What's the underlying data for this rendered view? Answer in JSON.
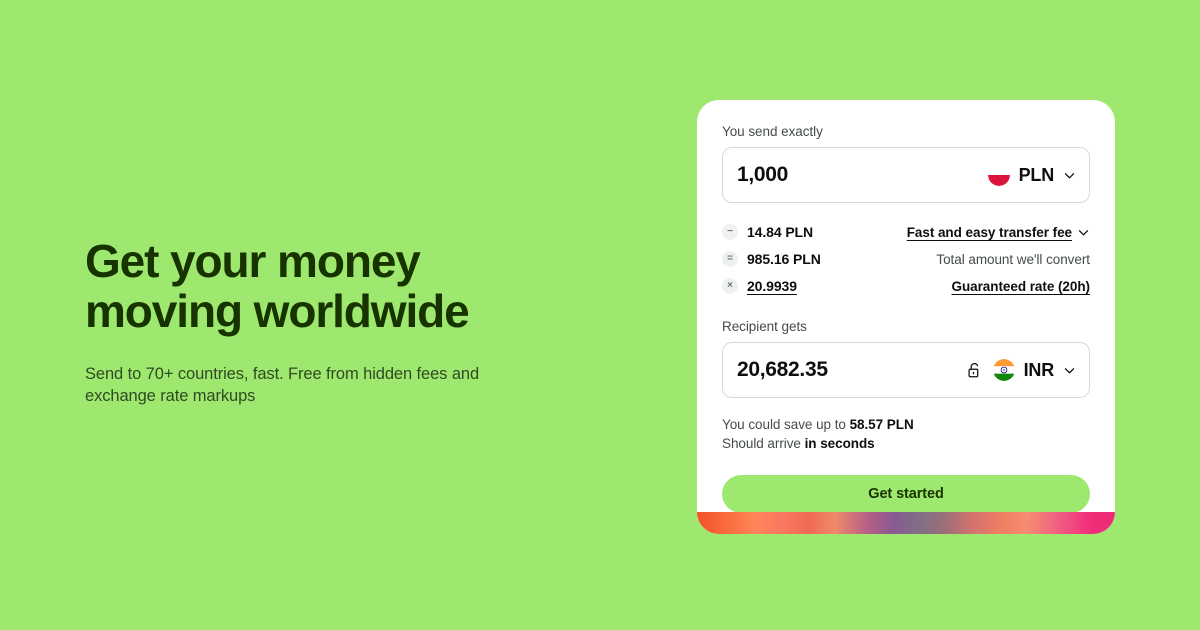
{
  "theme": {
    "background_green": "#9FE870",
    "text_dark": "#163300",
    "button_green": "#9FE870"
  },
  "hero": {
    "title": "Get your money moving worldwide",
    "subtitle": "Send to 70+ countries, fast. Free from hidden fees and exchange rate markups"
  },
  "calculator": {
    "send": {
      "label": "You send exactly",
      "amount": "1,000",
      "currency": "PLN",
      "flag": "poland-flag-icon",
      "chevron": "chevron-down-icon"
    },
    "breakdown": [
      {
        "operator": "−",
        "operator_name": "minus",
        "value": "14.84 PLN",
        "value_underlined": false,
        "description": "Fast and easy transfer fee",
        "description_is_link": true,
        "has_chevron": true
      },
      {
        "operator": "=",
        "operator_name": "equals",
        "value": "985.16 PLN",
        "value_underlined": false,
        "description": "Total amount we'll convert",
        "description_is_link": false,
        "has_chevron": false
      },
      {
        "operator": "×",
        "operator_name": "multiply",
        "value": "20.9939",
        "value_underlined": true,
        "description": "Guaranteed rate (20h)",
        "description_is_link": true,
        "has_chevron": false
      }
    ],
    "receive": {
      "label": "Recipient gets",
      "amount": "20,682.35",
      "currency": "INR",
      "flag": "india-flag-icon",
      "lock": "unlocked-padlock-icon",
      "chevron": "chevron-down-icon"
    },
    "notes": {
      "savings_prefix": "You could save up to ",
      "savings_amount": "58.57 PLN",
      "arrival_prefix": "Should arrive ",
      "arrival_value": "in seconds"
    },
    "cta_label": "Get started"
  }
}
